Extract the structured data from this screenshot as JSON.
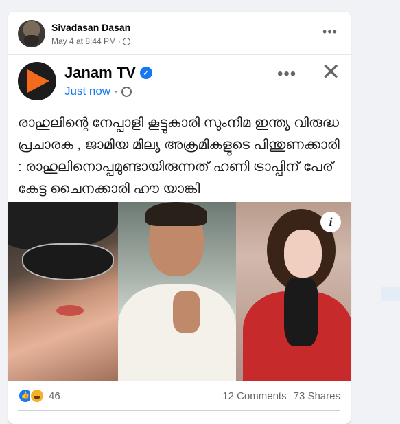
{
  "post": {
    "author": "Sivadasan Dasan",
    "date": "May 4 at 8:44 PM",
    "separator": "·",
    "more_label": "•••"
  },
  "shared": {
    "page_name": "Janam TV",
    "verified_mark": "✓",
    "time": "Just now",
    "separator": "·",
    "more_label": "•••",
    "close_label": "✕",
    "caption": "രാഹുലിന്റെ നേപ്പാളി കൂട്ടുകാരി സുംനിമ ഇന്ത്യ വിരുദ്ധ പ്രചാരക , ജാമിയ മില്യ അക്രമികളുടെ പിന്തുണക്കാരി : രാഹുലിനൊപ്പമുണ്ടായിരുന്നത് ഹണി ട്രാപ്പിന് പേര് കേട്ട ചൈനക്കാരി ഹൗ യാങ്കി",
    "info_label": "i"
  },
  "footer": {
    "like_glyph": "👍",
    "reaction_count": "46",
    "comments": "12 Comments",
    "shares": "73 Shares"
  },
  "colors": {
    "accent": "#1877f2",
    "brand_orange": "#f26b1d",
    "muted_text": "#65676b"
  }
}
